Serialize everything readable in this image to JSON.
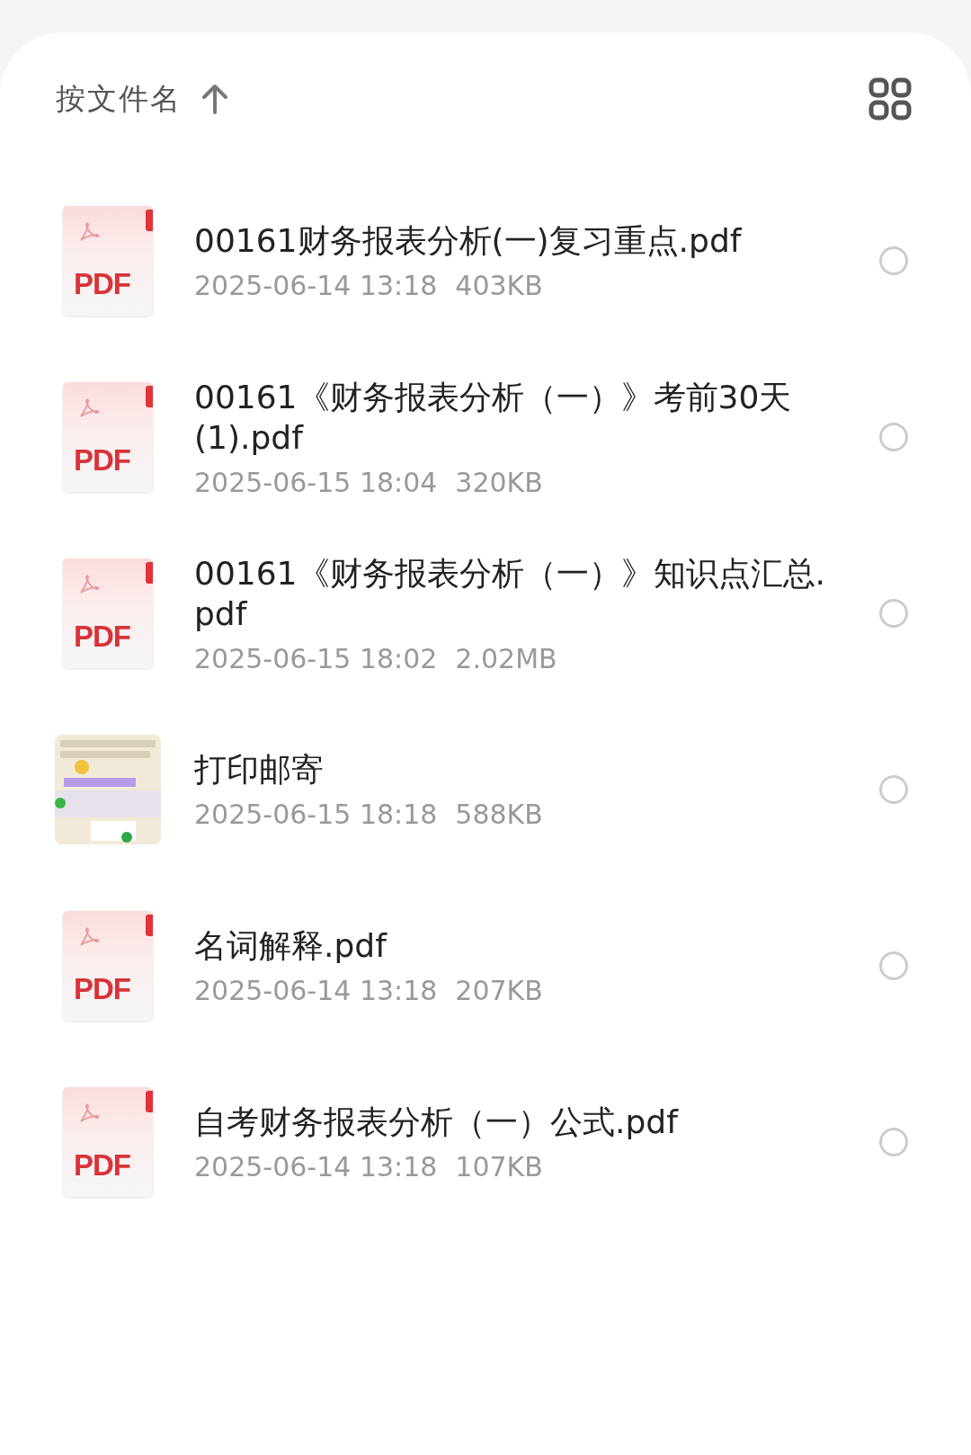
{
  "sort": {
    "label": "按文件名"
  },
  "files": [
    {
      "kind": "pdf",
      "badge": "PDF",
      "name": "00161财务报表分析(一)复习重点.pdf",
      "date": "2025-06-14 13:18",
      "size": "403KB",
      "selected": false
    },
    {
      "kind": "pdf",
      "badge": "PDF",
      "name": "00161《财务报表分析（一）》考前30天(1).pdf",
      "date": "2025-06-15 18:04",
      "size": "320KB",
      "selected": false
    },
    {
      "kind": "pdf",
      "badge": "PDF",
      "name": "00161《财务报表分析（一）》知识点汇总.pdf",
      "date": "2025-06-15 18:02",
      "size": "2.02MB",
      "selected": false
    },
    {
      "kind": "picture",
      "name": "打印邮寄",
      "date": "2025-06-15 18:18",
      "size": "588KB",
      "selected": false
    },
    {
      "kind": "pdf",
      "badge": "PDF",
      "name": "名词解释.pdf",
      "date": "2025-06-14 13:18",
      "size": "207KB",
      "selected": false
    },
    {
      "kind": "pdf",
      "badge": "PDF",
      "name": "自考财务报表分析（一）公式.pdf",
      "date": "2025-06-14 13:18",
      "size": "107KB",
      "selected": false
    }
  ]
}
